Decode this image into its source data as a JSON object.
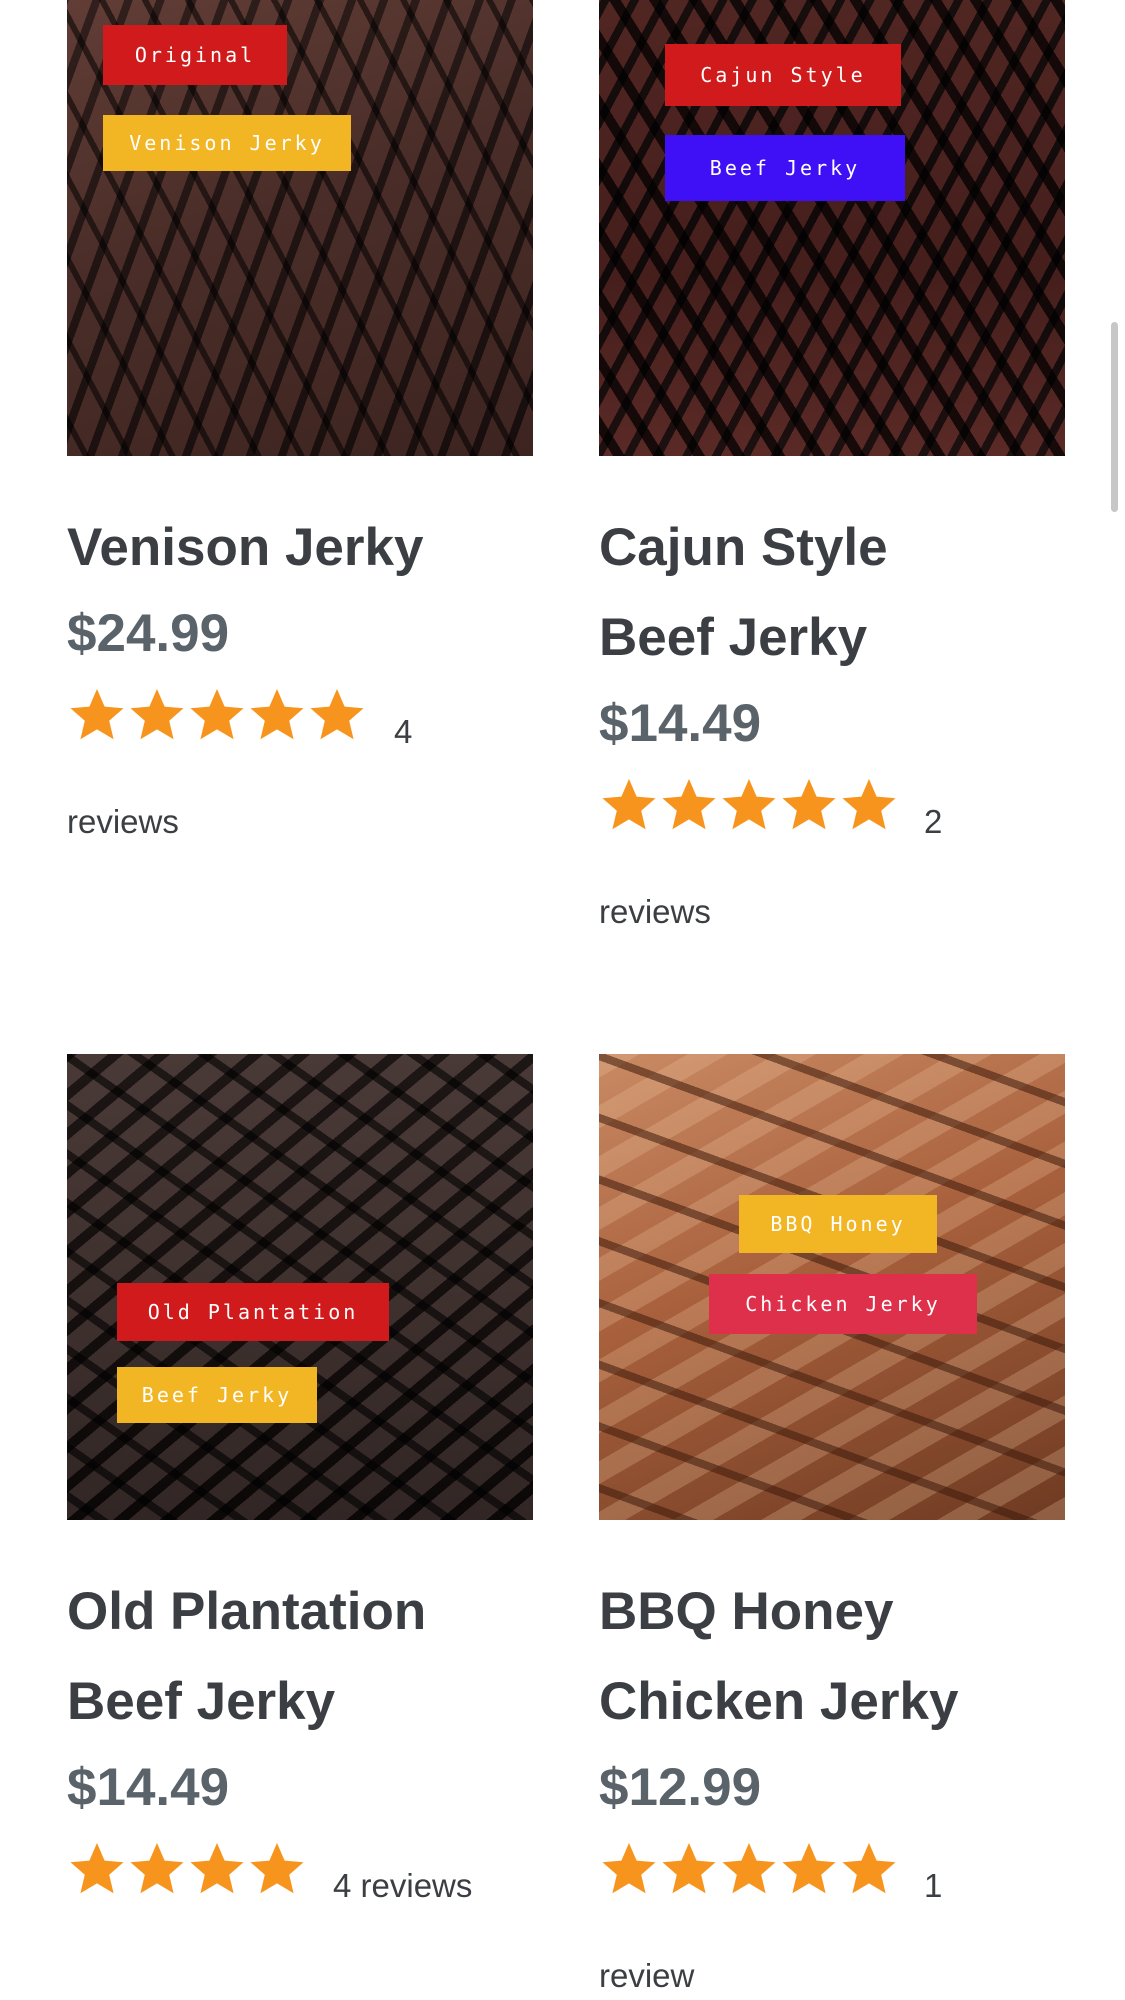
{
  "products": [
    {
      "name_line1": "Venison Jerky",
      "price": "$24.99",
      "rating": 5,
      "review_count": "4",
      "review_word": "reviews",
      "photo_tags": [
        "Original",
        "Venison Jerky"
      ],
      "tag_colors": [
        "#d11a1c",
        "#f2b625"
      ]
    },
    {
      "name_line1": "Cajun Style",
      "name_line2": "Beef Jerky",
      "price": "$14.49",
      "rating": 5,
      "review_count": "2",
      "review_word": "reviews",
      "photo_tags": [
        "Cajun Style",
        "Beef Jerky"
      ],
      "tag_colors": [
        "#d11a1c",
        "#3f10f5"
      ]
    },
    {
      "name_line1": "Old Plantation",
      "name_line2": "Beef Jerky",
      "price": "$14.49",
      "rating": 4,
      "reviews_inline": "4 reviews",
      "photo_tags": [
        "Old Plantation",
        "Beef Jerky"
      ],
      "tag_colors": [
        "#d11a1c",
        "#f2b625"
      ]
    },
    {
      "name_line1": "BBQ Honey",
      "name_line2": "Chicken Jerky",
      "price": "$12.99",
      "rating": 5,
      "review_count": "1",
      "review_word": "review",
      "photo_tags": [
        "BBQ Honey",
        "Chicken Jerky"
      ],
      "tag_colors": [
        "#f2b625",
        "#de2f4b"
      ]
    }
  ],
  "colors": {
    "star": "#f7941d",
    "title": "#3b3e43",
    "price": "#5b636a"
  }
}
